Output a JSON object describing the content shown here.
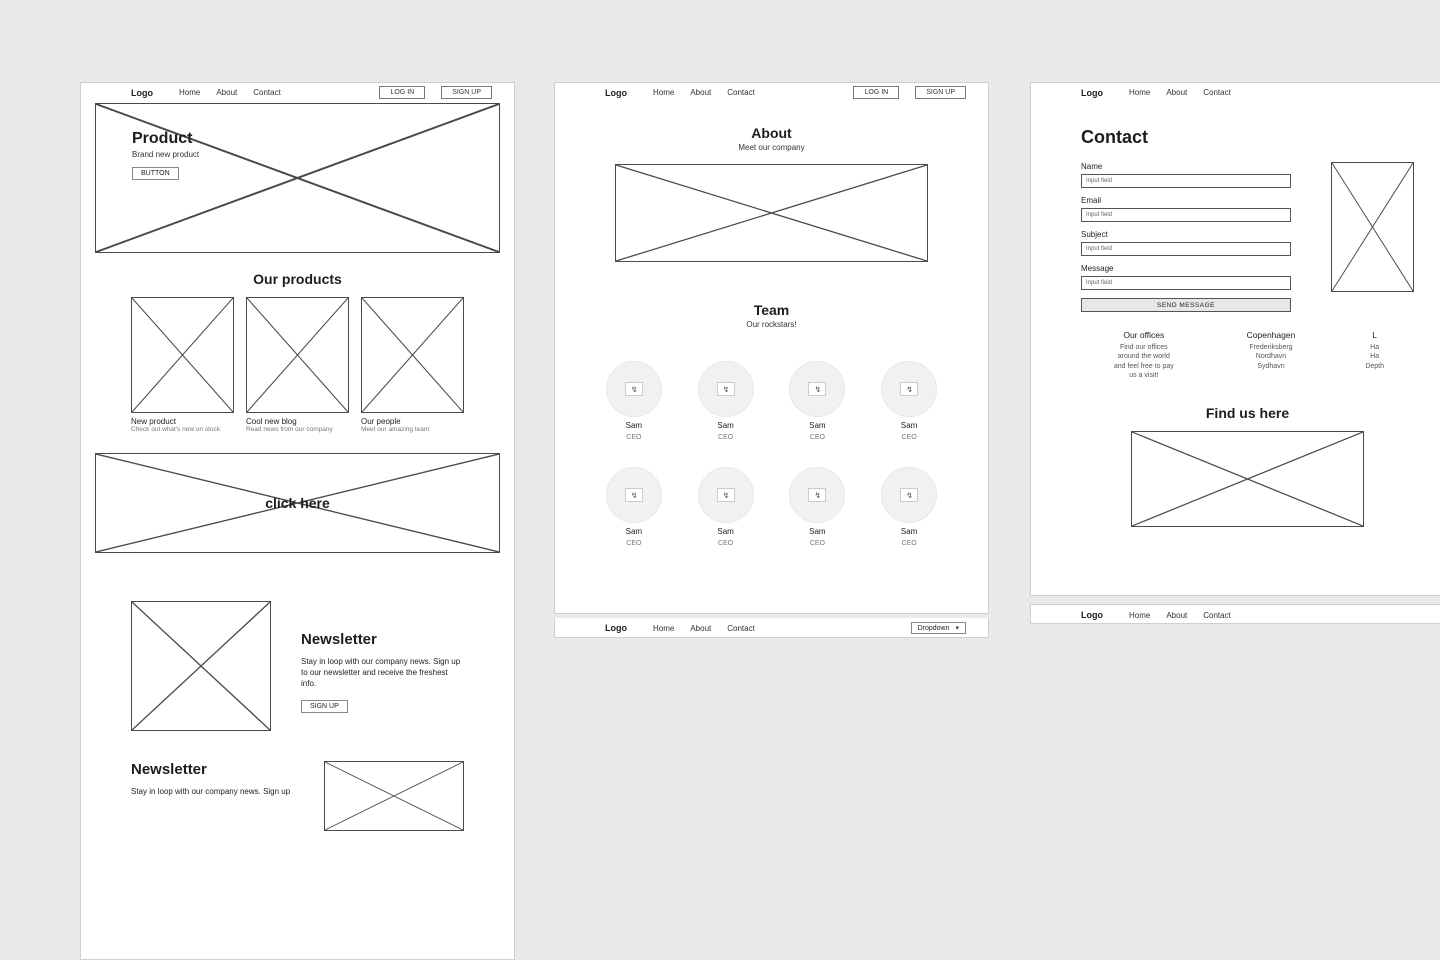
{
  "nav": {
    "logo": "Logo",
    "links": [
      "Home",
      "About",
      "Contact"
    ],
    "login": "LOG IN",
    "signup": "SIGN UP",
    "dropdown": "Dropdown"
  },
  "frame1": {
    "hero": {
      "title": "Product",
      "subtitle": "Brand new product",
      "button": "BUTTON"
    },
    "products": {
      "heading": "Our products",
      "cards": [
        {
          "title": "New product",
          "caption": "Check out what's new on stock"
        },
        {
          "title": "Cool new blog",
          "caption": "Read news from our company"
        },
        {
          "title": "Our people",
          "caption": "Meet our amazing team"
        }
      ]
    },
    "click_banner": "click here",
    "newsletter": {
      "title": "Newsletter",
      "body": "Stay in loop with our company news. Sign up to our newsletter and receive the freshest info.",
      "button": "SIGN UP"
    },
    "newsletter2": {
      "title": "Newsletter",
      "body": "Stay in loop with our company news. Sign up"
    }
  },
  "frame2": {
    "about": {
      "title": "About",
      "subtitle": "Meet our company"
    },
    "team": {
      "title": "Team",
      "subtitle": "Our rockstars!"
    },
    "members": [
      {
        "name": "Sam",
        "role": "CEO"
      },
      {
        "name": "Sam",
        "role": "CEO"
      },
      {
        "name": "Sam",
        "role": "CEO"
      },
      {
        "name": "Sam",
        "role": "CEO"
      },
      {
        "name": "Sam",
        "role": "CEO"
      },
      {
        "name": "Sam",
        "role": "CEO"
      },
      {
        "name": "Sam",
        "role": "CEO"
      },
      {
        "name": "Sam",
        "role": "CEO"
      }
    ]
  },
  "frame3": {
    "title": "Contact",
    "form": {
      "name": {
        "label": "Name",
        "placeholder": "Input field"
      },
      "email": {
        "label": "Email",
        "placeholder": "Input field"
      },
      "subject": {
        "label": "Subject",
        "placeholder": "Input field"
      },
      "message": {
        "label": "Message",
        "placeholder": "Input field"
      },
      "send": "SEND MESSAGE"
    },
    "offices_hd": {
      "title": "Our offices",
      "body": "Find our offices around the world and feel free to pay us a visit!"
    },
    "offices": [
      {
        "city": "Copenhagen",
        "l1": "Frederiksberg",
        "l2": "Nordhavn",
        "l3": "Sydhavn"
      },
      {
        "city": "L",
        "l1": "Ha",
        "l2": "Ha",
        "l3": "Depth"
      }
    ],
    "findus": "Find us here"
  }
}
